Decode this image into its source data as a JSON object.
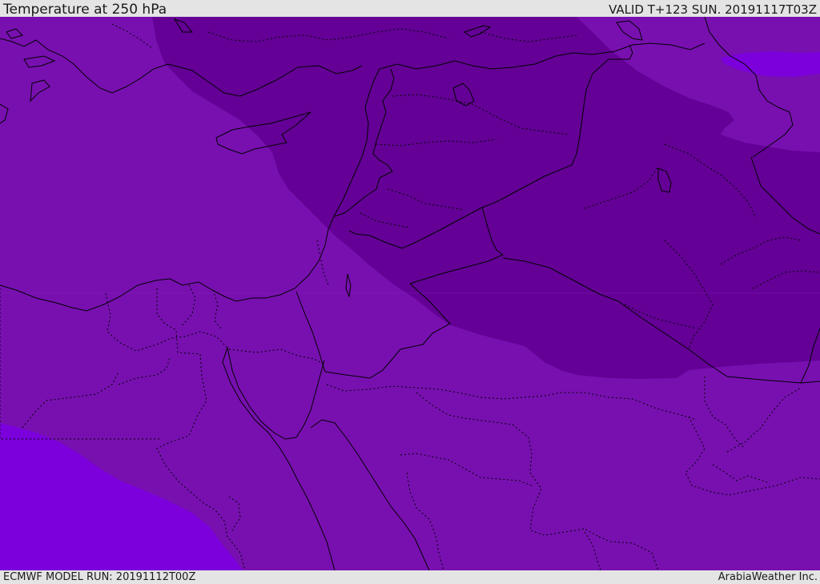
{
  "header": {
    "title": "Temperature at 250 hPa",
    "valid_time": "VALID T+123 SUN. 20191117T03Z"
  },
  "footer": {
    "model_run": "ECMWF MODEL RUN: 20191112T00Z",
    "credit": "ArabiaWeather Inc."
  },
  "map": {
    "field": "temperature",
    "pressure_level_hpa": 250,
    "shading": {
      "mid_band": "#7810b0",
      "cold_band": "#640096",
      "warm_band": "#7b00dc"
    },
    "boundary_color": "#000000",
    "contours_visible": false,
    "legend_visible": false
  }
}
